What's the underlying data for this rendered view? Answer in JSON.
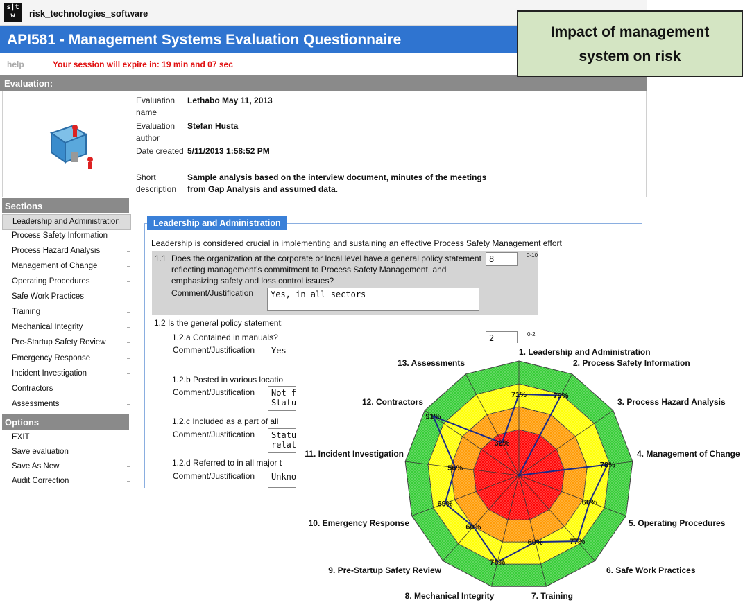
{
  "app": {
    "company": "risk_technologies_software",
    "logo_text": [
      "s|t",
      "w"
    ],
    "title": "API581 - Management Systems Evaluation Questionnaire",
    "help": "help",
    "session_msg": "Your session will expire in: 19 min and 07 sec",
    "evaluation_header": "Evaluation:"
  },
  "evaluation": {
    "name_label": "Evaluation name",
    "name": "Lethabo May 11, 2013",
    "author_label": "Evaluation author",
    "author": "Stefan Husta",
    "date_label": "Date created",
    "date": "5/11/2013 1:58:52 PM",
    "desc_label": "Short description",
    "desc": "Sample analysis based on the interview document, minutes of the meetings from Gap Analysis and assumed data."
  },
  "sidebar": {
    "sections_header": "Sections",
    "sections": [
      "Leadership and Administration",
      "Process Safety Information",
      "Process Hazard Analysis",
      "Management of Change",
      "Operating Procedures",
      "Safe Work Practices",
      "Training",
      "Mechanical Integrity",
      "Pre-Startup Safety Review",
      "Emergency Response",
      "Incident Investigation",
      "Contractors",
      "Assessments"
    ],
    "options_header": "Options",
    "options": [
      "EXIT",
      "Save evaluation",
      "Save As New",
      "Audit Correction"
    ]
  },
  "content": {
    "tab": "Leadership and Administration",
    "intro": "Leadership is considered crucial in implementing and sustaining an effective Process Safety Management effort",
    "q11_num": "1.1",
    "q11_text": "Does the organization at the corporate or local level have a general policy statement reflecting management's commitment to Process Safety Management, and emphasizing safety and loss control issues?",
    "q11_value": "8",
    "q11_range": "0-10",
    "comment_label": "Comment/Justification",
    "q11_comment": "Yes, in all sectors",
    "q12_text": "1.2 Is the general policy statement:",
    "q12a_text": "1.2.a Contained in manuals?",
    "q12a_value": "2",
    "q12a_range": "0-2",
    "q12a_comment": "Yes",
    "q12b_text": "1.2.b Posted in various locatio",
    "q12b_comment_l1": "Not f",
    "q12b_comment_l2": "Statu",
    "q12c_text": "1.2.c Included as a part of all",
    "q12c_comment_l1": "Statu",
    "q12c_comment_l2": "relat",
    "q12d_text": "1.2.d Referred to in all major t",
    "q12d_comment_l1": "Unkno"
  },
  "callout": {
    "line1": "Impact of management",
    "line2": "system on risk"
  },
  "chart_data": {
    "type": "radar",
    "title": "",
    "categories": [
      "1. Leadership and Administration",
      "2. Process Safety Information",
      "3. Process Hazard Analysis",
      "4. Management of Change",
      "5. Operating Procedures",
      "6. Safe Work Practices",
      "7. Training",
      "8. Mechanical Integrity",
      "9. Pre-Startup Safety Review",
      "10. Emergency Response",
      "11. Incident Investigation",
      "12. Contractors",
      "13. Assessments"
    ],
    "series": [
      {
        "values": [
          71,
          79,
          0,
          78,
          66,
          77,
          60,
          78,
          60,
          69,
          56,
          91,
          32
        ]
      }
    ],
    "data_labels": [
      "71%",
      "79%",
      "",
      "78%",
      "66%",
      "77%",
      "60%",
      "78%",
      "60%",
      "69%",
      "56%",
      "91%",
      "32%"
    ],
    "ylim": [
      0,
      100
    ],
    "bands": [
      {
        "to": 40,
        "color": "#ff0000"
      },
      {
        "to": 60,
        "color": "#ff9900"
      },
      {
        "to": 80,
        "color": "#ffff00"
      },
      {
        "to": 100,
        "color": "#33cc33"
      }
    ],
    "line_color": "#1a2a8a"
  }
}
